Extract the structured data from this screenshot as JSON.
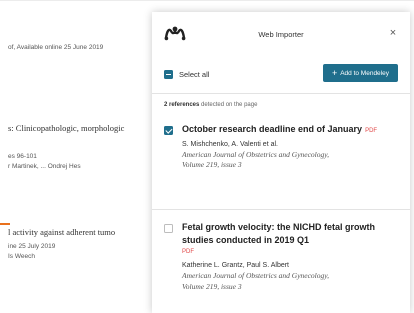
{
  "background_article": {
    "lines": [
      "of, Available online 25 June 2019",
      "s: Clinicopathologic, morphologic",
      "es 96-101",
      "r Martinek, ... Ondrej Hes",
      "l activity against adherent tumo",
      "ine 25 July 2019",
      "Is Weech"
    ]
  },
  "importer": {
    "title": "Web Importer",
    "close_glyph": "×",
    "select_all_label": "Select all",
    "add_button_plus": "+",
    "add_button_label": "Add to Mendeley",
    "refs_count_number": "2 references",
    "refs_count_suffix": "detected on the page",
    "accent_color": "#1f6e8c",
    "pdf_color": "#e04848",
    "references": [
      {
        "checked": true,
        "title": "October research deadline end of January",
        "pdf": "PDF",
        "authors": "S. Mishchenko, A. Valenti et al.",
        "journal_line1": "American Journal of Obstetrics and Gynecology,",
        "journal_line2": "Volume 219, issue 3"
      },
      {
        "checked": false,
        "title": "Fetal growth velocity: the NICHD fetal growth studies conducted in 2019 Q1",
        "pdf": "PDF",
        "authors": "Katherine L. Grantz, Paul S. Albert",
        "journal_line1": "American Journal of Obstetrics and Gynecology,",
        "journal_line2": "Volume 219, issue 3"
      }
    ]
  }
}
